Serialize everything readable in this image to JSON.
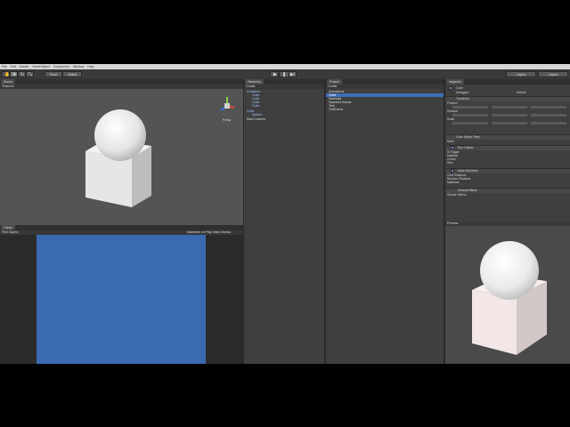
{
  "window": {
    "title": "Unity"
  },
  "menu": [
    "File",
    "Edit",
    "Assets",
    "GameObject",
    "Component",
    "Window",
    "Help"
  ],
  "toolbar": {
    "tools": [
      "hand-icon",
      "move-icon",
      "rotate-icon",
      "scale-icon"
    ],
    "pivot_label": "Pivot",
    "global_label": "Global",
    "layers_label": "Layers",
    "layout_label": "Layout"
  },
  "scene": {
    "tab_label": "Scene",
    "shaded_label": "Textured",
    "gizmo_label": "Persp"
  },
  "game": {
    "tab_label": "Game",
    "aspect_label": "Free Aspect",
    "right_labels": "Maximize on Play  Stats  Gizmos",
    "bg_color": "#3a6ab0"
  },
  "hierarchy": {
    "tab_label": "Hierarchy",
    "create_label": "Create",
    "rows": [
      {
        "label": "Container",
        "color": "blue"
      },
      {
        "label": "Cube",
        "color": "blue"
      },
      {
        "label": "Cube",
        "color": "blue"
      },
      {
        "label": "Cube",
        "color": "blue"
      },
      {
        "label": "Cube",
        "color": "blue"
      },
      {
        "label": "Cube",
        "color": "blue"
      },
      {
        "label": "Sphere",
        "color": "blue"
      },
      {
        "label": "Main Camera",
        "color": "white"
      }
    ]
  },
  "project": {
    "tab_label": "Project",
    "create_label": "Create",
    "rows": [
      {
        "label": "Animations",
        "selected": false
      },
      {
        "label": "Cube",
        "selected": true
      },
      {
        "label": "Materials",
        "selected": false
      },
      {
        "label": "Standard Assets",
        "selected": false
      },
      {
        "label": "Test",
        "selected": false
      },
      {
        "label": "TestScene",
        "selected": false
      }
    ]
  },
  "inspector": {
    "tab_label": "Inspector",
    "object_name": "Cube",
    "tag_label": "Untagged",
    "layer_label": "Default",
    "sections": [
      {
        "header": "Transform",
        "rows": [
          "Position",
          "Rotation",
          "Scale"
        ]
      },
      {
        "header": "Cube (Mesh Filter)",
        "rows": [
          "Mesh"
        ]
      },
      {
        "header": "Box Collider",
        "rows": [
          "Is Trigger",
          "Material",
          "Center",
          "Size"
        ]
      },
      {
        "header": "Mesh Renderer",
        "rows": [
          "Cast Shadows",
          "Receive Shadows",
          "Materials"
        ]
      },
      {
        "header": "Default-Diffuse",
        "rows": [
          "Shader  Diffuse"
        ]
      }
    ]
  },
  "preview": {
    "label": "Preview"
  }
}
